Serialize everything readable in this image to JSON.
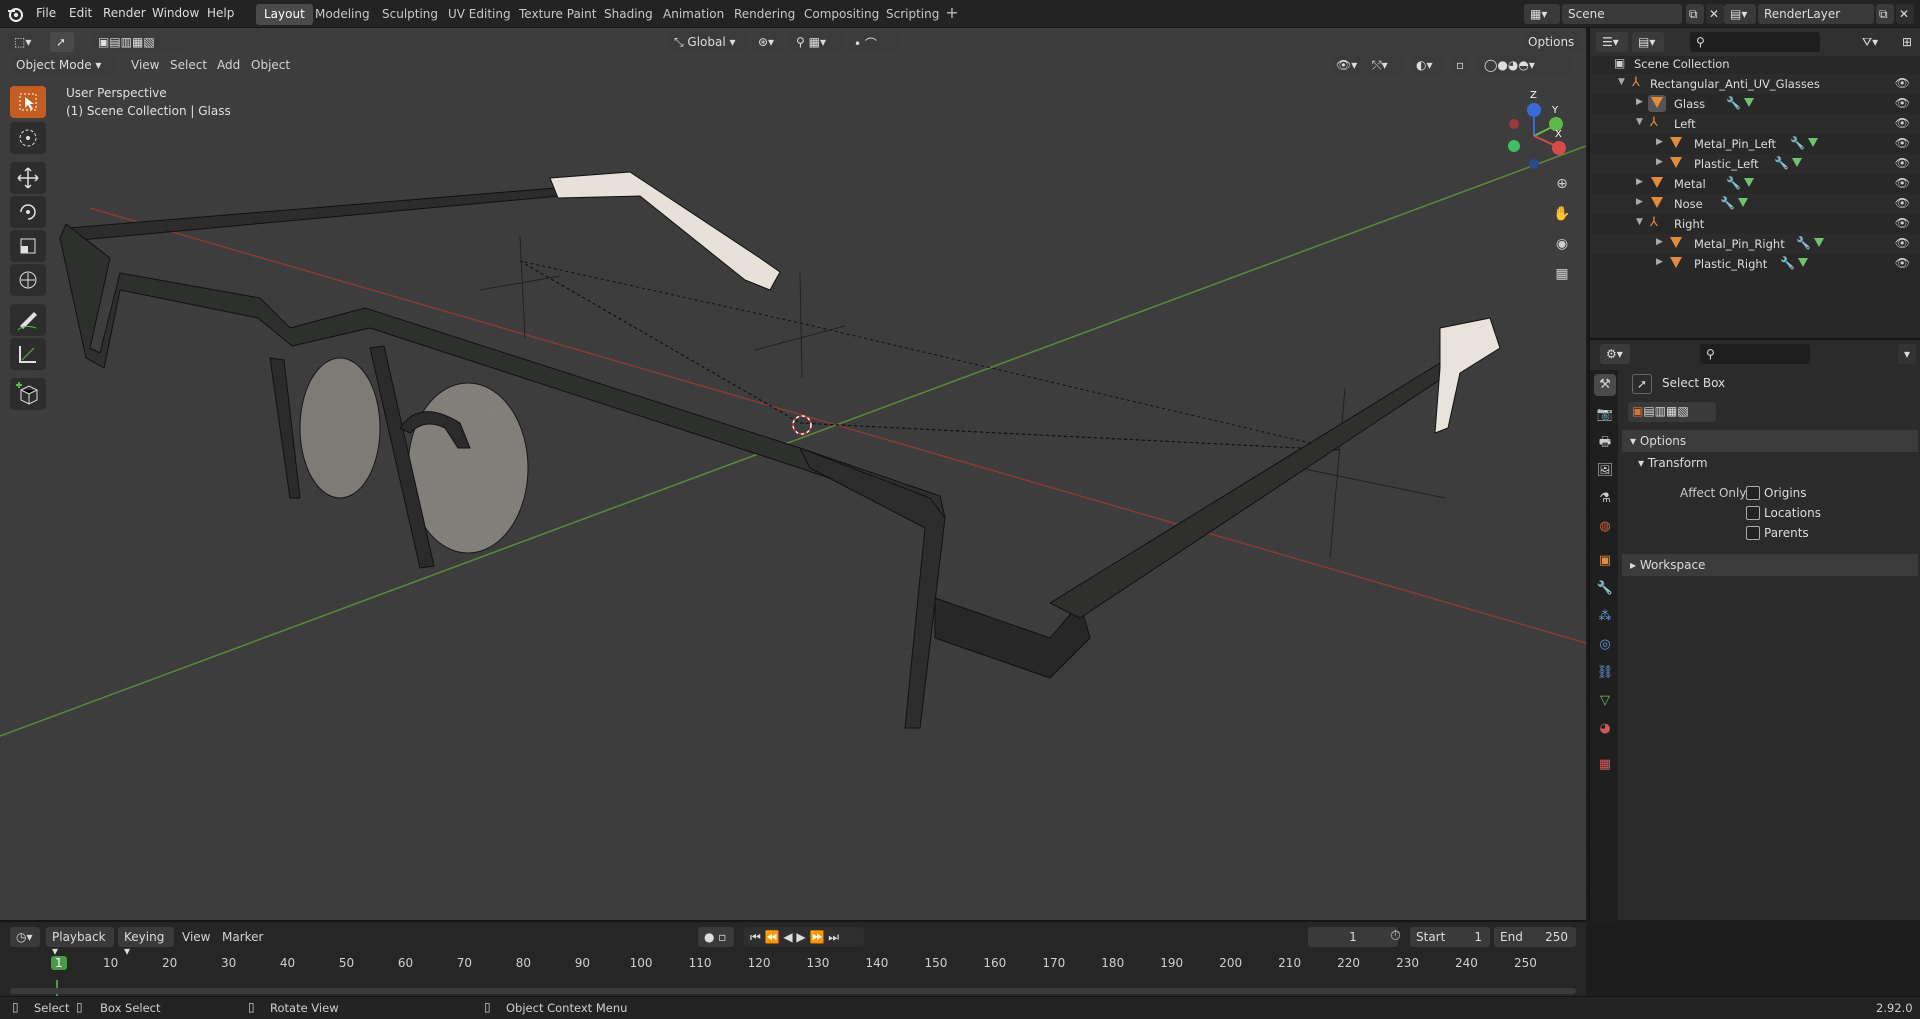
{
  "top_menu": {
    "items": [
      "File",
      "Edit",
      "Render",
      "Window",
      "Help"
    ],
    "workspaces": [
      "Layout",
      "Modeling",
      "Sculpting",
      "UV Editing",
      "Texture Paint",
      "Shading",
      "Animation",
      "Rendering",
      "Compositing",
      "Scripting"
    ],
    "active_workspace": "Layout",
    "add_label": "+",
    "scene": "Scene",
    "render_layer": "RenderLayer"
  },
  "viewport_header": {
    "mode": "Object Mode",
    "menus": [
      "View",
      "Select",
      "Add",
      "Object"
    ],
    "orientation": "Global",
    "options_label": "Options"
  },
  "viewport": {
    "perspective": "User Perspective",
    "collection_info": "(1) Scene Collection | Glass",
    "axis_labels": {
      "x": "X",
      "y": "Y",
      "z": "Z"
    }
  },
  "outliner": {
    "rows": [
      {
        "label": "Scene Collection",
        "type": "collection"
      },
      {
        "label": "Rectangular_Anti_UV_Glasses",
        "type": "empty"
      },
      {
        "label": "Glass",
        "type": "mesh"
      },
      {
        "label": "Left",
        "type": "empty"
      },
      {
        "label": "Metal_Pin_Left",
        "type": "mesh"
      },
      {
        "label": "Plastic_Left",
        "type": "mesh"
      },
      {
        "label": "Metal",
        "type": "mesh"
      },
      {
        "label": "Nose",
        "type": "mesh"
      },
      {
        "label": "Right",
        "type": "empty"
      },
      {
        "label": "Metal_Pin_Right",
        "type": "mesh"
      },
      {
        "label": "Plastic_Right",
        "type": "mesh"
      }
    ]
  },
  "properties": {
    "tool_name": "Select Box",
    "options_panel": "Options",
    "transform_panel": "Transform",
    "affect_only_label": "Affect Only",
    "checkboxes": [
      "Origins",
      "Locations",
      "Parents"
    ],
    "workspace_panel": "Workspace"
  },
  "timeline": {
    "playback": "Playback",
    "keying": "Keying",
    "view": "View",
    "marker": "Marker",
    "current_frame": "1",
    "start_label": "Start",
    "start_value": "1",
    "end_label": "End",
    "end_value": "250",
    "ticks": [
      "1",
      "10",
      "20",
      "30",
      "40",
      "50",
      "60",
      "70",
      "80",
      "90",
      "100",
      "110",
      "120",
      "130",
      "140",
      "150",
      "160",
      "170",
      "180",
      "190",
      "200",
      "210",
      "220",
      "230",
      "240",
      "250"
    ]
  },
  "statusbar": {
    "select": "Select",
    "box_select": "Box Select",
    "rotate_view": "Rotate View",
    "context_menu": "Object Context Menu",
    "version": "2.92.0"
  }
}
